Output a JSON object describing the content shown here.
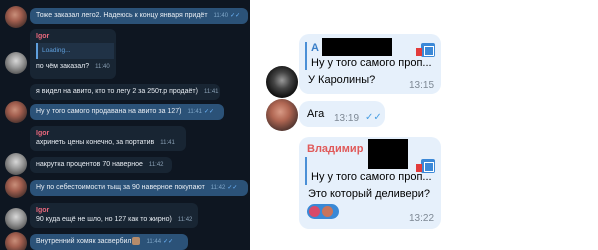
{
  "left_chat": {
    "messages": [
      {
        "text": "Тоже заказал лего2. Надеюсь к концу января придёт",
        "time": "11:40",
        "ticks": "✓✓"
      },
      {
        "sender": "Igor",
        "reply_preview": "Loading...",
        "text": "по чём заказал?",
        "time": "11:40"
      },
      {
        "text": "я видел на авито, кто то легу 2 за 250т.р продаёт)",
        "time": "11:41"
      },
      {
        "text": "Ну у того самого продавана на авито за 127)",
        "time": "11:41",
        "ticks": "✓✓"
      },
      {
        "sender": "Igor",
        "text": "ахринеть цены конечно, за портатив",
        "time": "11:41"
      },
      {
        "text": "накрутка процентов 70 наверное",
        "time": "11:42"
      },
      {
        "text": "Ну по себестоимости тыщ за 90 наверное покупают",
        "time": "11:42",
        "ticks": "✓✓"
      },
      {
        "sender": "Igor",
        "text": "90 куда ещё не шло, но 127 как то жирно)",
        "time": "11:42"
      },
      {
        "text": "Внутренний хомяк засвербил",
        "time": "11:44",
        "ticks": "✓✓"
      }
    ]
  },
  "right_chat": {
    "msg1": {
      "quote_initial": "А",
      "quote_text": "Ну у того самого проп...",
      "text": "У Каролины?",
      "time": "13:15"
    },
    "msg2": {
      "text": "Ага",
      "time": "13:19",
      "ticks": "✓✓"
    },
    "msg3": {
      "sender": "Владимир",
      "quote_text": "Ну у того самого проп...",
      "text": "Это который деливери?",
      "time": "13:22"
    }
  },
  "colors": {
    "left_bg": "#0e1621",
    "out_bubble": "#2b5278",
    "in_bubble": "#182533",
    "sender_red": "#e8687c",
    "right_bubble": "#e6f0fb",
    "check_blue": "#4a9fe3"
  }
}
